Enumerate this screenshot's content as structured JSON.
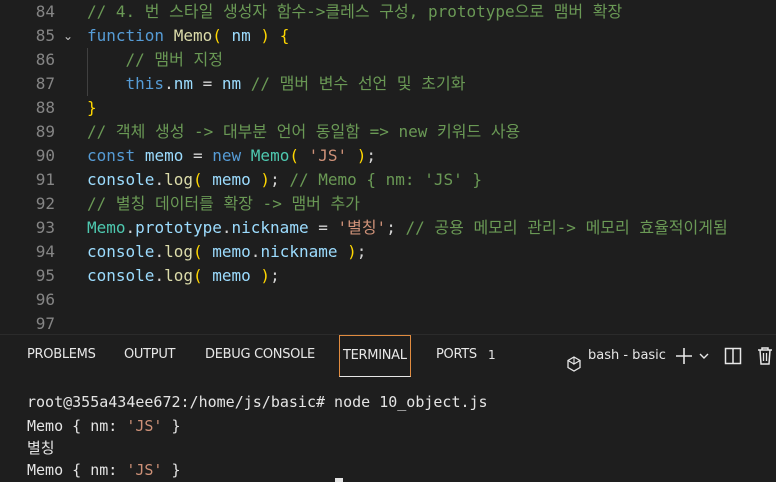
{
  "editor": {
    "lines": [
      {
        "num": "84",
        "tokens": [
          {
            "t": "// 4. 번 스타일 생성자 함수->클레스 구성, prototype으로 맴버 확장",
            "c": "c-com"
          }
        ]
      },
      {
        "num": "85",
        "fold": "⌄",
        "tokens": [
          {
            "t": "function",
            "c": "c-kw"
          },
          {
            "t": " ",
            "c": "c-punc"
          },
          {
            "t": "Memo",
            "c": "c-fn"
          },
          {
            "t": "(",
            "c": "c-br1"
          },
          {
            "t": " nm ",
            "c": "c-var"
          },
          {
            "t": ")",
            "c": "c-br1"
          },
          {
            "t": " ",
            "c": "c-punc"
          },
          {
            "t": "{",
            "c": "c-br1"
          }
        ]
      },
      {
        "num": "86",
        "indent": "    ",
        "tokens": [
          {
            "t": "// 맴버 지정",
            "c": "c-com"
          }
        ]
      },
      {
        "num": "87",
        "indent": "    ",
        "tokens": [
          {
            "t": "this",
            "c": "c-kw"
          },
          {
            "t": ".",
            "c": "c-punc"
          },
          {
            "t": "nm",
            "c": "c-var"
          },
          {
            "t": " = ",
            "c": "c-punc"
          },
          {
            "t": "nm",
            "c": "c-var"
          },
          {
            "t": " ",
            "c": "c-punc"
          },
          {
            "t": "// 맴버 변수 선언 및 초기화",
            "c": "c-com"
          }
        ]
      },
      {
        "num": "88",
        "tokens": [
          {
            "t": "}",
            "c": "c-br1"
          }
        ]
      },
      {
        "num": "89",
        "tokens": [
          {
            "t": "// 객체 생성 -> 대부분 언어 동일함 => new 키워드 사용",
            "c": "c-com"
          }
        ]
      },
      {
        "num": "90",
        "tokens": [
          {
            "t": "const",
            "c": "c-kw"
          },
          {
            "t": " ",
            "c": "c-punc"
          },
          {
            "t": "memo",
            "c": "c-var"
          },
          {
            "t": " = ",
            "c": "c-punc"
          },
          {
            "t": "new",
            "c": "c-kw"
          },
          {
            "t": " ",
            "c": "c-punc"
          },
          {
            "t": "Memo",
            "c": "c-cls"
          },
          {
            "t": "(",
            "c": "c-br1"
          },
          {
            "t": " ",
            "c": "c-punc"
          },
          {
            "t": "'JS'",
            "c": "c-str"
          },
          {
            "t": " ",
            "c": "c-punc"
          },
          {
            "t": ")",
            "c": "c-br1"
          },
          {
            "t": ";",
            "c": "c-punc"
          }
        ]
      },
      {
        "num": "91",
        "tokens": [
          {
            "t": "console",
            "c": "c-var"
          },
          {
            "t": ".",
            "c": "c-punc"
          },
          {
            "t": "log",
            "c": "c-fn"
          },
          {
            "t": "(",
            "c": "c-br1"
          },
          {
            "t": " memo ",
            "c": "c-var"
          },
          {
            "t": ")",
            "c": "c-br1"
          },
          {
            "t": "; ",
            "c": "c-punc"
          },
          {
            "t": "// Memo { nm: 'JS' }",
            "c": "c-com"
          }
        ]
      },
      {
        "num": "92",
        "tokens": [
          {
            "t": "// 별칭 데이터를 확장 -> 맴버 추가",
            "c": "c-com"
          }
        ]
      },
      {
        "num": "93",
        "tokens": [
          {
            "t": "Memo",
            "c": "c-cls"
          },
          {
            "t": ".",
            "c": "c-punc"
          },
          {
            "t": "prototype",
            "c": "c-var"
          },
          {
            "t": ".",
            "c": "c-punc"
          },
          {
            "t": "nickname",
            "c": "c-var"
          },
          {
            "t": " = ",
            "c": "c-punc"
          },
          {
            "t": "'별칭'",
            "c": "c-str"
          },
          {
            "t": "; ",
            "c": "c-punc"
          },
          {
            "t": "// 공용 메모리 관리-> 메모리 효율적이게됨",
            "c": "c-com"
          }
        ]
      },
      {
        "num": "94",
        "tokens": [
          {
            "t": "console",
            "c": "c-var"
          },
          {
            "t": ".",
            "c": "c-punc"
          },
          {
            "t": "log",
            "c": "c-fn"
          },
          {
            "t": "(",
            "c": "c-br1"
          },
          {
            "t": " memo",
            "c": "c-var"
          },
          {
            "t": ".",
            "c": "c-punc"
          },
          {
            "t": "nickname ",
            "c": "c-var"
          },
          {
            "t": ")",
            "c": "c-br1"
          },
          {
            "t": ";",
            "c": "c-punc"
          }
        ]
      },
      {
        "num": "95",
        "tokens": [
          {
            "t": "console",
            "c": "c-var"
          },
          {
            "t": ".",
            "c": "c-punc"
          },
          {
            "t": "log",
            "c": "c-fn"
          },
          {
            "t": "(",
            "c": "c-br1"
          },
          {
            "t": " memo ",
            "c": "c-var"
          },
          {
            "t": ")",
            "c": "c-br1"
          },
          {
            "t": ";",
            "c": "c-punc"
          }
        ]
      },
      {
        "num": "96",
        "tokens": []
      },
      {
        "num": "97",
        "tokens": []
      }
    ]
  },
  "panel": {
    "tabs": [
      {
        "label": "PROBLEMS",
        "name": "tab-problems"
      },
      {
        "label": "OUTPUT",
        "name": "tab-output"
      },
      {
        "label": "DEBUG CONSOLE",
        "name": "tab-debug-console"
      },
      {
        "label": "TERMINAL",
        "name": "tab-terminal",
        "active": true
      },
      {
        "label": "PORTS",
        "name": "tab-ports"
      }
    ],
    "ports_badge": "1",
    "terminal_name": "bash - basic",
    "icons": {
      "terminal": "terminal-shell-icon",
      "add": "plus-icon",
      "dropdown": "chevron-down-icon",
      "split": "split-terminal-icon",
      "delete": "trash-icon"
    }
  },
  "terminal": {
    "prompt": "root@355a434ee672:/home/js/basic# node 10_object.js",
    "output": [
      {
        "pre": "Memo { nm: ",
        "str": "'JS'",
        "post": " }"
      },
      {
        "pre": "별칭",
        "str": "",
        "post": ""
      },
      {
        "pre": "Memo { nm: ",
        "str": "'JS'",
        "post": " }"
      }
    ]
  }
}
